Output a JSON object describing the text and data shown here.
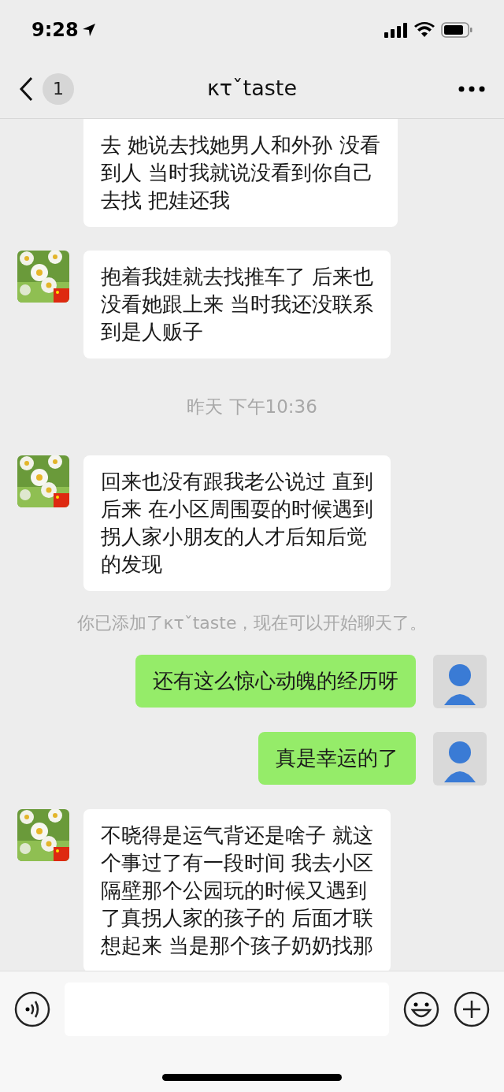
{
  "status_bar": {
    "time": "9:28"
  },
  "header": {
    "unread_count": "1",
    "title": "κτˇtaste"
  },
  "messages": [
    {
      "kind": "incoming",
      "avatar": false,
      "lines": [
        "去 她说去找她男人和外孙  没看",
        "到人 当时我就说没看到你自己",
        "去找 把娃还我"
      ]
    },
    {
      "kind": "incoming",
      "avatar": true,
      "lines": [
        "抱着我娃就去找推车了 后来也",
        "没看她跟上来  当时我还没联系",
        "到是人贩子"
      ]
    },
    {
      "kind": "time",
      "text": "昨天 下午10:36"
    },
    {
      "kind": "incoming",
      "avatar": true,
      "lines": [
        "回来也没有跟我老公说过 直到",
        "后来 在小区周围耍的时候遇到",
        "拐人家小朋友的人才后知后觉",
        "的发现"
      ]
    },
    {
      "kind": "system",
      "text": "你已添加了κτˇtaste，现在可以开始聊天了。"
    },
    {
      "kind": "outgoing",
      "avatar": true,
      "lines": [
        "还有这么惊心动魄的经历呀"
      ]
    },
    {
      "kind": "outgoing",
      "avatar": true,
      "lines": [
        "真是幸运的了"
      ]
    },
    {
      "kind": "incoming",
      "avatar": true,
      "lines": [
        "不晓得是运气背还是啥子 就这",
        "个事过了有一段时间  我去小区",
        "隔壁那个公园玩的时候又遇到",
        "了真拐人家的孩子的 后面才联",
        "想起来 当是那个孩子奶奶找那"
      ]
    }
  ]
}
